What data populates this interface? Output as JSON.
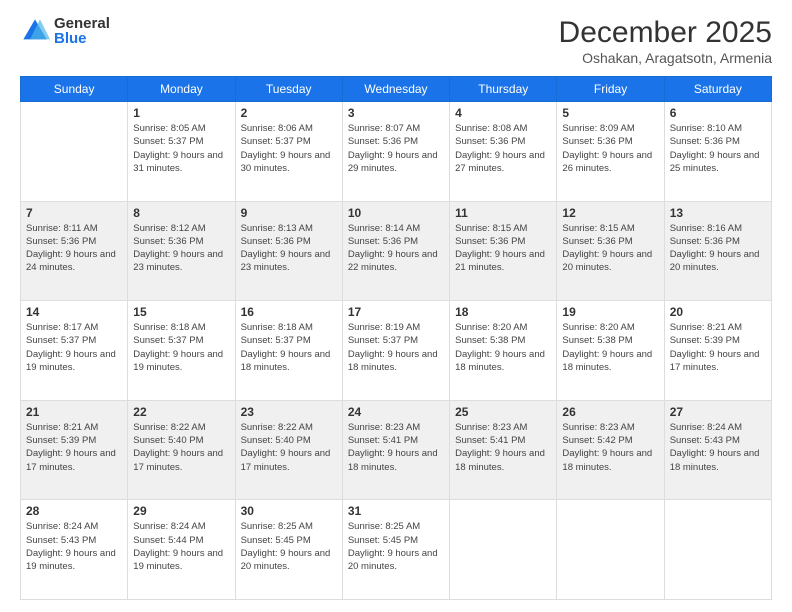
{
  "logo": {
    "general": "General",
    "blue": "Blue"
  },
  "header": {
    "month": "December 2025",
    "location": "Oshakan, Aragatsotn, Armenia"
  },
  "weekdays": [
    "Sunday",
    "Monday",
    "Tuesday",
    "Wednesday",
    "Thursday",
    "Friday",
    "Saturday"
  ],
  "weeks": [
    [
      {
        "day": "",
        "sunrise": "",
        "sunset": "",
        "daylight": ""
      },
      {
        "day": "1",
        "sunrise": "Sunrise: 8:05 AM",
        "sunset": "Sunset: 5:37 PM",
        "daylight": "Daylight: 9 hours and 31 minutes."
      },
      {
        "day": "2",
        "sunrise": "Sunrise: 8:06 AM",
        "sunset": "Sunset: 5:37 PM",
        "daylight": "Daylight: 9 hours and 30 minutes."
      },
      {
        "day": "3",
        "sunrise": "Sunrise: 8:07 AM",
        "sunset": "Sunset: 5:36 PM",
        "daylight": "Daylight: 9 hours and 29 minutes."
      },
      {
        "day": "4",
        "sunrise": "Sunrise: 8:08 AM",
        "sunset": "Sunset: 5:36 PM",
        "daylight": "Daylight: 9 hours and 27 minutes."
      },
      {
        "day": "5",
        "sunrise": "Sunrise: 8:09 AM",
        "sunset": "Sunset: 5:36 PM",
        "daylight": "Daylight: 9 hours and 26 minutes."
      },
      {
        "day": "6",
        "sunrise": "Sunrise: 8:10 AM",
        "sunset": "Sunset: 5:36 PM",
        "daylight": "Daylight: 9 hours and 25 minutes."
      }
    ],
    [
      {
        "day": "7",
        "sunrise": "Sunrise: 8:11 AM",
        "sunset": "Sunset: 5:36 PM",
        "daylight": "Daylight: 9 hours and 24 minutes."
      },
      {
        "day": "8",
        "sunrise": "Sunrise: 8:12 AM",
        "sunset": "Sunset: 5:36 PM",
        "daylight": "Daylight: 9 hours and 23 minutes."
      },
      {
        "day": "9",
        "sunrise": "Sunrise: 8:13 AM",
        "sunset": "Sunset: 5:36 PM",
        "daylight": "Daylight: 9 hours and 23 minutes."
      },
      {
        "day": "10",
        "sunrise": "Sunrise: 8:14 AM",
        "sunset": "Sunset: 5:36 PM",
        "daylight": "Daylight: 9 hours and 22 minutes."
      },
      {
        "day": "11",
        "sunrise": "Sunrise: 8:15 AM",
        "sunset": "Sunset: 5:36 PM",
        "daylight": "Daylight: 9 hours and 21 minutes."
      },
      {
        "day": "12",
        "sunrise": "Sunrise: 8:15 AM",
        "sunset": "Sunset: 5:36 PM",
        "daylight": "Daylight: 9 hours and 20 minutes."
      },
      {
        "day": "13",
        "sunrise": "Sunrise: 8:16 AM",
        "sunset": "Sunset: 5:36 PM",
        "daylight": "Daylight: 9 hours and 20 minutes."
      }
    ],
    [
      {
        "day": "14",
        "sunrise": "Sunrise: 8:17 AM",
        "sunset": "Sunset: 5:37 PM",
        "daylight": "Daylight: 9 hours and 19 minutes."
      },
      {
        "day": "15",
        "sunrise": "Sunrise: 8:18 AM",
        "sunset": "Sunset: 5:37 PM",
        "daylight": "Daylight: 9 hours and 19 minutes."
      },
      {
        "day": "16",
        "sunrise": "Sunrise: 8:18 AM",
        "sunset": "Sunset: 5:37 PM",
        "daylight": "Daylight: 9 hours and 18 minutes."
      },
      {
        "day": "17",
        "sunrise": "Sunrise: 8:19 AM",
        "sunset": "Sunset: 5:37 PM",
        "daylight": "Daylight: 9 hours and 18 minutes."
      },
      {
        "day": "18",
        "sunrise": "Sunrise: 8:20 AM",
        "sunset": "Sunset: 5:38 PM",
        "daylight": "Daylight: 9 hours and 18 minutes."
      },
      {
        "day": "19",
        "sunrise": "Sunrise: 8:20 AM",
        "sunset": "Sunset: 5:38 PM",
        "daylight": "Daylight: 9 hours and 18 minutes."
      },
      {
        "day": "20",
        "sunrise": "Sunrise: 8:21 AM",
        "sunset": "Sunset: 5:39 PM",
        "daylight": "Daylight: 9 hours and 17 minutes."
      }
    ],
    [
      {
        "day": "21",
        "sunrise": "Sunrise: 8:21 AM",
        "sunset": "Sunset: 5:39 PM",
        "daylight": "Daylight: 9 hours and 17 minutes."
      },
      {
        "day": "22",
        "sunrise": "Sunrise: 8:22 AM",
        "sunset": "Sunset: 5:40 PM",
        "daylight": "Daylight: 9 hours and 17 minutes."
      },
      {
        "day": "23",
        "sunrise": "Sunrise: 8:22 AM",
        "sunset": "Sunset: 5:40 PM",
        "daylight": "Daylight: 9 hours and 17 minutes."
      },
      {
        "day": "24",
        "sunrise": "Sunrise: 8:23 AM",
        "sunset": "Sunset: 5:41 PM",
        "daylight": "Daylight: 9 hours and 18 minutes."
      },
      {
        "day": "25",
        "sunrise": "Sunrise: 8:23 AM",
        "sunset": "Sunset: 5:41 PM",
        "daylight": "Daylight: 9 hours and 18 minutes."
      },
      {
        "day": "26",
        "sunrise": "Sunrise: 8:23 AM",
        "sunset": "Sunset: 5:42 PM",
        "daylight": "Daylight: 9 hours and 18 minutes."
      },
      {
        "day": "27",
        "sunrise": "Sunrise: 8:24 AM",
        "sunset": "Sunset: 5:43 PM",
        "daylight": "Daylight: 9 hours and 18 minutes."
      }
    ],
    [
      {
        "day": "28",
        "sunrise": "Sunrise: 8:24 AM",
        "sunset": "Sunset: 5:43 PM",
        "daylight": "Daylight: 9 hours and 19 minutes."
      },
      {
        "day": "29",
        "sunrise": "Sunrise: 8:24 AM",
        "sunset": "Sunset: 5:44 PM",
        "daylight": "Daylight: 9 hours and 19 minutes."
      },
      {
        "day": "30",
        "sunrise": "Sunrise: 8:25 AM",
        "sunset": "Sunset: 5:45 PM",
        "daylight": "Daylight: 9 hours and 20 minutes."
      },
      {
        "day": "31",
        "sunrise": "Sunrise: 8:25 AM",
        "sunset": "Sunset: 5:45 PM",
        "daylight": "Daylight: 9 hours and 20 minutes."
      },
      {
        "day": "",
        "sunrise": "",
        "sunset": "",
        "daylight": ""
      },
      {
        "day": "",
        "sunrise": "",
        "sunset": "",
        "daylight": ""
      },
      {
        "day": "",
        "sunrise": "",
        "sunset": "",
        "daylight": ""
      }
    ]
  ]
}
